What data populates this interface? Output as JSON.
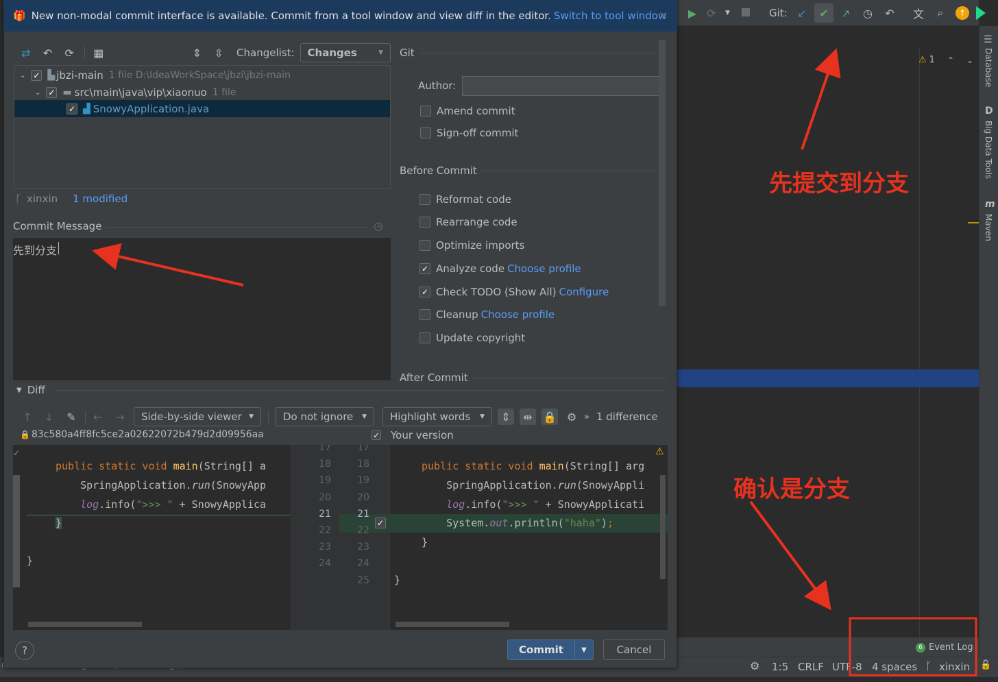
{
  "banner": {
    "message": "New non-modal commit interface is available. Commit from a tool window and view diff in the editor.",
    "link": "Switch to tool window"
  },
  "toolbar": {
    "changelist_label": "Changelist:",
    "changelist_value": "Changes"
  },
  "tree": {
    "root": {
      "name": "jbzi-main",
      "meta": "1 file  D:\\IdeaWorkSpace\\jbzi\\jbzi-main"
    },
    "folder": {
      "name": "src\\main\\java\\vip\\xiaonuo",
      "meta": "1 file"
    },
    "file": {
      "name": "SnowyApplication.java"
    }
  },
  "branch": {
    "name": "xinxin",
    "status": "1 modified"
  },
  "commit_message": {
    "label": "Commit Message",
    "value": "先到分支"
  },
  "git": {
    "title": "Git",
    "author_label": "Author:",
    "author_value": "",
    "amend": "Amend commit",
    "signoff": "Sign-off commit"
  },
  "before_commit": {
    "title": "Before Commit",
    "reformat": "Reformat code",
    "rearrange": "Rearrange code",
    "optimize": "Optimize imports",
    "analyze": "Analyze code",
    "analyze_link": "Choose profile",
    "todo": "Check TODO (Show All)",
    "todo_link": "Configure",
    "cleanup": "Cleanup",
    "cleanup_link": "Choose profile",
    "copyright": "Update copyright"
  },
  "after_commit": {
    "title": "After Commit"
  },
  "diff": {
    "title": "Diff",
    "viewer": "Side-by-side viewer",
    "ignore": "Do not ignore",
    "highlight": "Highlight words",
    "more": "»",
    "count": "1 difference",
    "left_hash": "83c580a4ff8fc5ce2a02622072b479d2d09956aa",
    "right_title": "Your version",
    "line_numbers_left": [
      "17",
      "18",
      "19",
      "20",
      "21",
      "22",
      "23",
      "24"
    ],
    "line_numbers_right": [
      "17",
      "18",
      "19",
      "20",
      "21",
      "22",
      "23",
      "24",
      "25"
    ]
  },
  "buttons": {
    "commit": "Commit",
    "cancel": "Cancel",
    "help": "?"
  },
  "ide": {
    "git_label": "Git:",
    "warnings": "1",
    "side_database": "Database",
    "side_bigdata": "Big Data Tools",
    "side_maven": "Maven",
    "event_log_count": "6",
    "event_log": "Event Log",
    "status_pos": "1:5",
    "status_crlf": "CRLF",
    "status_enc": "UTF-8",
    "status_indent": "4 spaces",
    "status_branch": "xinxin",
    "status_left": "d... Rollback  Configure... (5 minutes ago)"
  },
  "annotations": {
    "top": "先提交到分支",
    "bottom": "确认是分支"
  },
  "colors": {
    "annotation": "#e6321e",
    "link": "#589df6",
    "selection": "#0d293e",
    "commit_button": "#365880"
  }
}
